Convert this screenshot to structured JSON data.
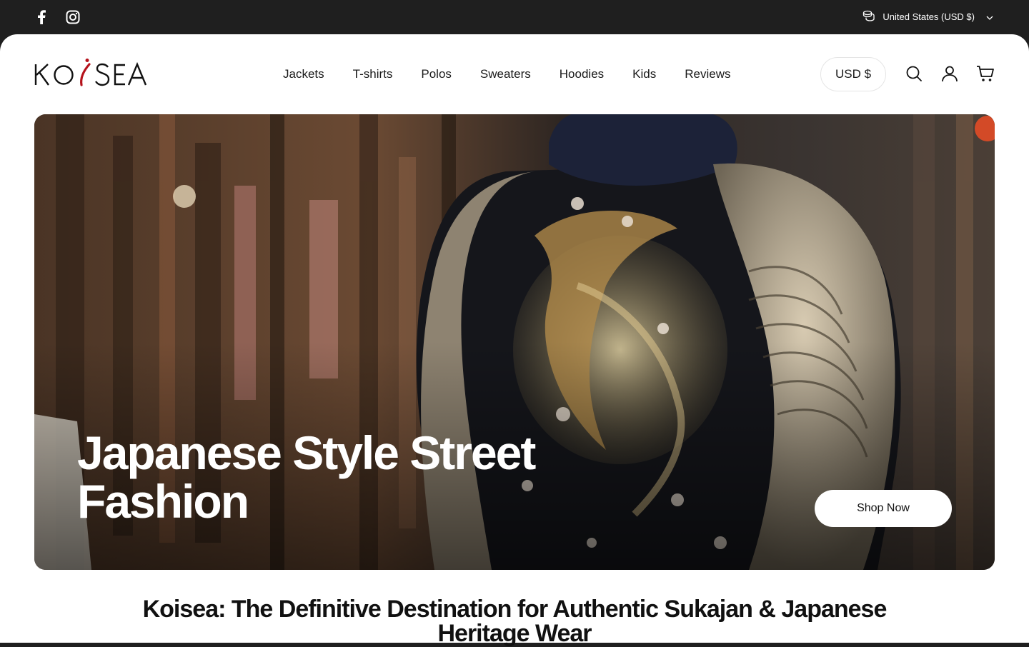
{
  "topbar": {
    "social": [
      {
        "icon": "facebook-icon"
      },
      {
        "icon": "instagram-icon"
      }
    ],
    "region_label": "United States (USD $)"
  },
  "header": {
    "logo_text": "KOISEA",
    "nav": [
      "Jackets",
      "T-shirts",
      "Polos",
      "Sweaters",
      "Hoodies",
      "Kids",
      "Reviews"
    ],
    "currency_label": "USD $",
    "icons": [
      "search-icon",
      "account-icon",
      "cart-icon"
    ]
  },
  "hero": {
    "title": "Japanese Style Street Fashion",
    "cta_label": "Shop Now"
  },
  "intro": {
    "heading": "Koisea: The Definitive Destination for Authentic Sukajan & Japanese Heritage Wear"
  },
  "colors": {
    "topbar_bg": "#1f1f1f",
    "accent_red": "#b5121b",
    "text": "#1a1a1a"
  }
}
